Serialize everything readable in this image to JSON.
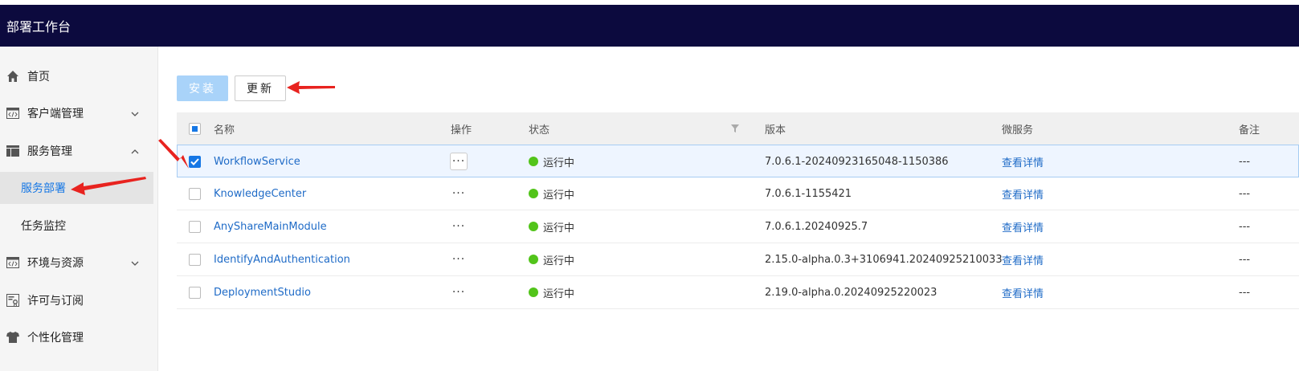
{
  "header": {
    "title": "部署工作台"
  },
  "sidebar": {
    "items": [
      {
        "label": "首页",
        "icon": "home-icon"
      },
      {
        "label": "客户端管理",
        "icon": "code-window-icon",
        "chevron": "down"
      },
      {
        "label": "服务管理",
        "icon": "layout-icon",
        "chevron": "up"
      },
      {
        "label": "服务部署",
        "sub": true,
        "active": true
      },
      {
        "label": "任务监控",
        "sub": true
      },
      {
        "label": "环境与资源",
        "icon": "code-window-icon",
        "chevron": "down"
      },
      {
        "label": "许可与订阅",
        "icon": "license-icon"
      },
      {
        "label": "个性化管理",
        "icon": "shirt-icon"
      }
    ]
  },
  "toolbar": {
    "install_label": "安装",
    "update_label": "更新"
  },
  "table": {
    "columns": {
      "name": "名称",
      "ops": "操作",
      "status": "状态",
      "version": "版本",
      "micro": "微服务",
      "note": "备注"
    },
    "rows": [
      {
        "name": "WorkflowService",
        "status": "运行中",
        "version": "7.0.6.1-20240923165048-1150386",
        "micro": "查看详情",
        "note": "---",
        "checked": true
      },
      {
        "name": "KnowledgeCenter",
        "status": "运行中",
        "version": "7.0.6.1-1155421",
        "micro": "查看详情",
        "note": "---",
        "checked": false
      },
      {
        "name": "AnyShareMainModule",
        "status": "运行中",
        "version": "7.0.6.1.20240925.7",
        "micro": "查看详情",
        "note": "---",
        "checked": false
      },
      {
        "name": "IdentifyAndAuthentication",
        "status": "运行中",
        "version": "2.15.0-alpha.0.3+3106941.20240925210033",
        "micro": "查看详情",
        "note": "---",
        "checked": false
      },
      {
        "name": "DeploymentStudio",
        "status": "运行中",
        "version": "2.19.0-alpha.0.20240925220023",
        "micro": "查看详情",
        "note": "---",
        "checked": false
      }
    ]
  },
  "colors": {
    "header_bg": "#0c0a3e",
    "accent": "#1677e5",
    "running": "#52c41a",
    "annotation": "#e8231f"
  }
}
